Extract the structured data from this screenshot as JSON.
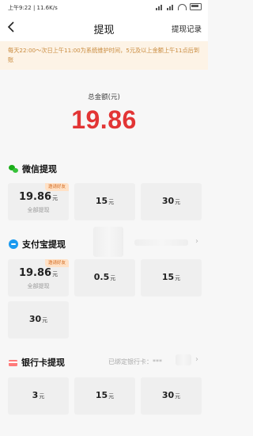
{
  "status": {
    "time": "上午9:22",
    "speed": "11.6K/s"
  },
  "nav": {
    "title": "提现",
    "record": "提现记录"
  },
  "notice": {
    "text": "每天22:00～次日上午11:00为系统维护时间，5元及以上金额上午11点后到账"
  },
  "total": {
    "label": "总金额(元)",
    "value": "19.86"
  },
  "unit": "元",
  "wechat": {
    "title": "微信提现",
    "options": [
      {
        "amount": "19.86",
        "tag": "邀请好友",
        "sub": "全部提现"
      },
      {
        "amount": "15"
      },
      {
        "amount": "30"
      }
    ]
  },
  "alipay": {
    "title": "支付宝提现",
    "options": [
      {
        "amount": "19.86",
        "tag": "邀请好友",
        "sub": "全部提现"
      },
      {
        "amount": "0.5"
      },
      {
        "amount": "15"
      },
      {
        "amount": "30"
      }
    ]
  },
  "bank": {
    "title": "银行卡提现",
    "bound_label": "已绑定银行卡：",
    "card_mask": "***",
    "options": [
      {
        "amount": "3"
      },
      {
        "amount": "15"
      },
      {
        "amount": "30"
      }
    ]
  },
  "colors": {
    "accent": "#e23535",
    "notice_bg": "#fdf3e6",
    "notice_text": "#c98b3e",
    "wechat": "#1aad19",
    "alipay": "#1a9af0",
    "bank": "#ff7a7a"
  }
}
